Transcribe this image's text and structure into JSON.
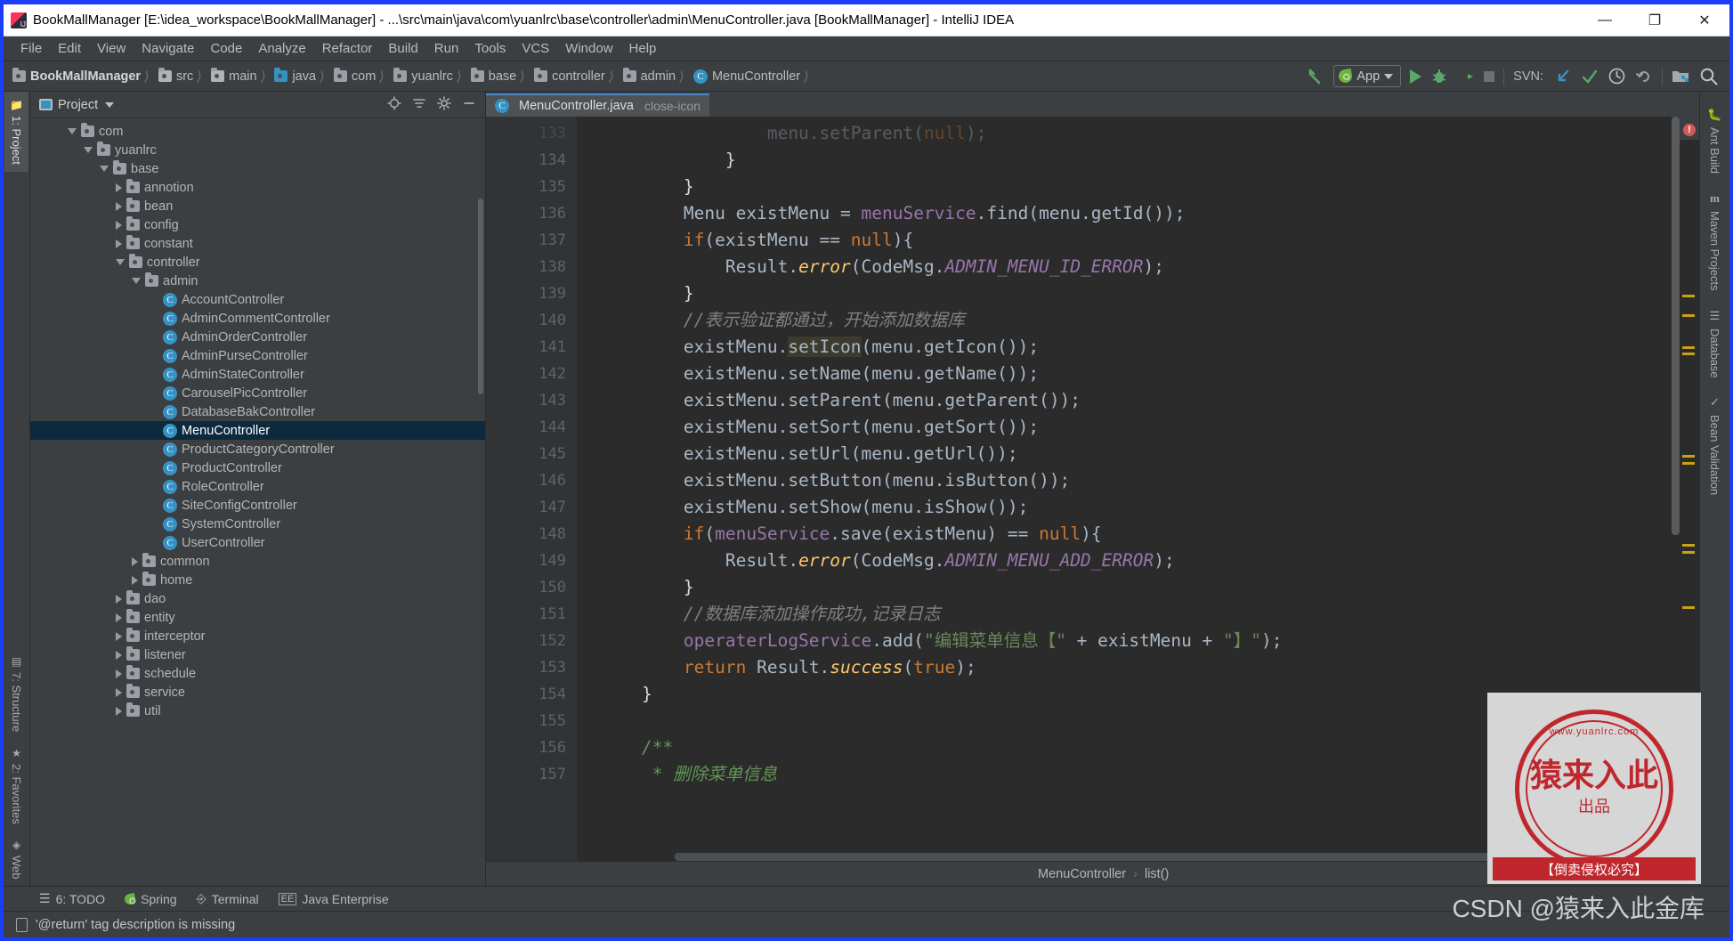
{
  "window": {
    "title": "BookMallManager [E:\\idea_workspace\\BookMallManager] - ...\\src\\main\\java\\com\\yuanlrc\\base\\controller\\admin\\MenuController.java [BookMallManager] - IntelliJ IDEA",
    "app_icon": "intellij-idea-icon",
    "minimize": "—",
    "maximize": "❐",
    "close": "✕"
  },
  "menubar": {
    "items": [
      {
        "label": "File"
      },
      {
        "label": "Edit"
      },
      {
        "label": "View"
      },
      {
        "label": "Navigate"
      },
      {
        "label": "Code"
      },
      {
        "label": "Analyze"
      },
      {
        "label": "Refactor"
      },
      {
        "label": "Build"
      },
      {
        "label": "Run"
      },
      {
        "label": "Tools"
      },
      {
        "label": "VCS"
      },
      {
        "label": "Window"
      },
      {
        "label": "Help"
      }
    ]
  },
  "navbar": {
    "breadcrumbs": [
      {
        "label": "BookMallManager",
        "icon": "project-folder-icon"
      },
      {
        "label": "src",
        "icon": "folder-icon"
      },
      {
        "label": "main",
        "icon": "folder-icon"
      },
      {
        "label": "java",
        "icon": "source-root-folder-icon"
      },
      {
        "label": "com",
        "icon": "package-icon"
      },
      {
        "label": "yuanlrc",
        "icon": "package-icon"
      },
      {
        "label": "base",
        "icon": "package-icon"
      },
      {
        "label": "controller",
        "icon": "package-icon"
      },
      {
        "label": "admin",
        "icon": "package-icon"
      },
      {
        "label": "MenuController",
        "icon": "java-class-icon"
      }
    ],
    "separator": "›",
    "toolbar": {
      "back_arrow_icon": "back-arrow-icon",
      "run_config_label": "App",
      "run_config_icon": "spring-leaf-icon",
      "dropdown_icon": "chevron-down-icon",
      "run_icon": "run-play-icon",
      "debug_icon": "debug-bug-icon",
      "run_coverage_icon": "run-with-coverage-icon",
      "stop_icon": "stop-square-icon",
      "svn_label": "SVN:",
      "svn_update_icon": "svn-update-icon",
      "svn_commit_icon": "svn-commit-check-icon",
      "svn_history_icon": "svn-history-clock-icon",
      "svn_revert_icon": "svn-revert-icon",
      "module_settings_icon": "project-structure-icon",
      "search_icon": "search-icon"
    }
  },
  "left_strip": {
    "tabs": [
      {
        "label": "1: Project",
        "icon": "project-folder-icon",
        "active": true
      },
      {
        "label": "7: Structure",
        "icon": "structure-icon",
        "active": false
      },
      {
        "label": "2: Favorites",
        "icon": "star-icon",
        "active": false
      },
      {
        "label": "Web",
        "icon": "web-globe-icon",
        "active": false
      }
    ]
  },
  "right_strip": {
    "tabs": [
      {
        "label": "Ant Build",
        "icon": "ant-icon"
      },
      {
        "label": "Maven Projects",
        "icon": "maven-m-icon"
      },
      {
        "label": "Database",
        "icon": "database-icon"
      },
      {
        "label": "Bean Validation",
        "icon": "bean-validation-icon"
      }
    ]
  },
  "project_panel": {
    "title": "Project",
    "title_dropdown_icon": "chevron-down-icon",
    "actions": [
      {
        "icon": "locate-target-icon"
      },
      {
        "icon": "collapse-all-icon"
      },
      {
        "icon": "settings-gear-icon"
      },
      {
        "icon": "hide-minus-icon"
      }
    ],
    "tree": [
      {
        "label": "com",
        "depth": 2,
        "state": "open",
        "icon": "package-icon",
        "selected": false
      },
      {
        "label": "yuanlrc",
        "depth": 3,
        "state": "open",
        "icon": "package-icon",
        "selected": false
      },
      {
        "label": "base",
        "depth": 4,
        "state": "open",
        "icon": "package-icon",
        "selected": false
      },
      {
        "label": "annotion",
        "depth": 5,
        "state": "closed",
        "icon": "package-icon",
        "selected": false
      },
      {
        "label": "bean",
        "depth": 5,
        "state": "closed",
        "icon": "package-icon",
        "selected": false
      },
      {
        "label": "config",
        "depth": 5,
        "state": "closed",
        "icon": "package-icon",
        "selected": false
      },
      {
        "label": "constant",
        "depth": 5,
        "state": "closed",
        "icon": "package-icon",
        "selected": false
      },
      {
        "label": "controller",
        "depth": 5,
        "state": "open",
        "icon": "package-icon",
        "selected": false
      },
      {
        "label": "admin",
        "depth": 6,
        "state": "open",
        "icon": "package-icon",
        "selected": false
      },
      {
        "label": "AccountController",
        "depth": 7,
        "state": "leaf",
        "icon": "java-class-icon",
        "selected": false
      },
      {
        "label": "AdminCommentController",
        "depth": 7,
        "state": "leaf",
        "icon": "java-class-icon",
        "selected": false
      },
      {
        "label": "AdminOrderController",
        "depth": 7,
        "state": "leaf",
        "icon": "java-class-icon",
        "selected": false
      },
      {
        "label": "AdminPurseController",
        "depth": 7,
        "state": "leaf",
        "icon": "java-class-icon",
        "selected": false
      },
      {
        "label": "AdminStateController",
        "depth": 7,
        "state": "leaf",
        "icon": "java-class-icon",
        "selected": false
      },
      {
        "label": "CarouselPicController",
        "depth": 7,
        "state": "leaf",
        "icon": "java-class-icon",
        "selected": false
      },
      {
        "label": "DatabaseBakController",
        "depth": 7,
        "state": "leaf",
        "icon": "java-class-icon",
        "selected": false
      },
      {
        "label": "MenuController",
        "depth": 7,
        "state": "leaf",
        "icon": "java-class-icon",
        "selected": true
      },
      {
        "label": "ProductCategoryController",
        "depth": 7,
        "state": "leaf",
        "icon": "java-class-icon",
        "selected": false
      },
      {
        "label": "ProductController",
        "depth": 7,
        "state": "leaf",
        "icon": "java-class-icon",
        "selected": false
      },
      {
        "label": "RoleController",
        "depth": 7,
        "state": "leaf",
        "icon": "java-class-icon",
        "selected": false
      },
      {
        "label": "SiteConfigController",
        "depth": 7,
        "state": "leaf",
        "icon": "java-class-icon",
        "selected": false
      },
      {
        "label": "SystemController",
        "depth": 7,
        "state": "leaf",
        "icon": "java-class-icon",
        "selected": false
      },
      {
        "label": "UserController",
        "depth": 7,
        "state": "leaf",
        "icon": "java-class-icon",
        "selected": false
      },
      {
        "label": "common",
        "depth": 6,
        "state": "closed",
        "icon": "package-icon",
        "selected": false
      },
      {
        "label": "home",
        "depth": 6,
        "state": "closed",
        "icon": "package-icon",
        "selected": false
      },
      {
        "label": "dao",
        "depth": 5,
        "state": "closed",
        "icon": "package-icon",
        "selected": false
      },
      {
        "label": "entity",
        "depth": 5,
        "state": "closed",
        "icon": "package-icon",
        "selected": false
      },
      {
        "label": "interceptor",
        "depth": 5,
        "state": "closed",
        "icon": "package-icon",
        "selected": false
      },
      {
        "label": "listener",
        "depth": 5,
        "state": "closed",
        "icon": "package-icon",
        "selected": false
      },
      {
        "label": "schedule",
        "depth": 5,
        "state": "closed",
        "icon": "package-icon",
        "selected": false
      },
      {
        "label": "service",
        "depth": 5,
        "state": "closed",
        "icon": "package-icon",
        "selected": false
      },
      {
        "label": "util",
        "depth": 5,
        "state": "closed",
        "icon": "package-icon",
        "selected": false
      }
    ]
  },
  "editor": {
    "tab": {
      "label": "MenuController.java",
      "icon": "java-class-icon",
      "close_icon": "close-icon"
    },
    "first_visible_line": 133,
    "lines": [
      {
        "num": "133",
        "fold": "",
        "segments": [
          {
            "t": "                menu.",
            "c": "plain"
          },
          {
            "t": "setParent",
            "c": "plain"
          },
          {
            "t": "(",
            "c": "plain"
          },
          {
            "t": "null",
            "c": "kw"
          },
          {
            "t": ");",
            "c": "plain"
          }
        ]
      },
      {
        "num": "134",
        "fold": "",
        "segments": [
          {
            "t": "            }",
            "c": "white"
          }
        ]
      },
      {
        "num": "135",
        "fold": "",
        "segments": [
          {
            "t": "        }",
            "c": "white"
          }
        ]
      },
      {
        "num": "136",
        "fold": "",
        "segments": [
          {
            "t": "        Menu existMenu = ",
            "c": "plain"
          },
          {
            "t": "menuService",
            "c": "fld"
          },
          {
            "t": ".find(menu.getId());",
            "c": "plain"
          }
        ]
      },
      {
        "num": "137",
        "fold": "",
        "segments": [
          {
            "t": "        ",
            "c": "plain"
          },
          {
            "t": "if",
            "c": "kw"
          },
          {
            "t": "(existMenu == ",
            "c": "plain"
          },
          {
            "t": "null",
            "c": "kw"
          },
          {
            "t": "){",
            "c": "plain"
          }
        ]
      },
      {
        "num": "138",
        "fold": "",
        "segments": [
          {
            "t": "            Result.",
            "c": "plain"
          },
          {
            "t": "error",
            "c": "it"
          },
          {
            "t": "(CodeMsg.",
            "c": "plain"
          },
          {
            "t": "ADMIN_MENU_ID_ERROR",
            "c": "fld-it"
          },
          {
            "t": ");",
            "c": "plain"
          }
        ]
      },
      {
        "num": "139",
        "fold": "",
        "segments": [
          {
            "t": "        }",
            "c": "white"
          }
        ]
      },
      {
        "num": "140",
        "fold": "",
        "segments": [
          {
            "t": "        //表示验证都通过，开始添加数据库",
            "c": "cmt"
          }
        ]
      },
      {
        "num": "141",
        "fold": "",
        "segments": [
          {
            "t": "        existMenu.",
            "c": "plain"
          },
          {
            "t": "setIcon",
            "c": "hl"
          },
          {
            "t": "(menu.getIcon());",
            "c": "plain"
          }
        ]
      },
      {
        "num": "142",
        "fold": "",
        "segments": [
          {
            "t": "        existMenu.setName(menu.getName());",
            "c": "plain"
          }
        ]
      },
      {
        "num": "143",
        "fold": "",
        "segments": [
          {
            "t": "        existMenu.setParent(menu.getParent());",
            "c": "plain"
          }
        ]
      },
      {
        "num": "144",
        "fold": "",
        "segments": [
          {
            "t": "        existMenu.setSort(menu.getSort());",
            "c": "plain"
          }
        ]
      },
      {
        "num": "145",
        "fold": "",
        "segments": [
          {
            "t": "        existMenu.setUrl(menu.getUrl());",
            "c": "plain"
          }
        ]
      },
      {
        "num": "146",
        "fold": "",
        "segments": [
          {
            "t": "        existMenu.setButton(menu.isButton());",
            "c": "plain"
          }
        ]
      },
      {
        "num": "147",
        "fold": "",
        "segments": [
          {
            "t": "        existMenu.setShow(menu.isShow());",
            "c": "plain"
          }
        ]
      },
      {
        "num": "148",
        "fold": "",
        "segments": [
          {
            "t": "        ",
            "c": "plain"
          },
          {
            "t": "if",
            "c": "kw"
          },
          {
            "t": "(",
            "c": "plain"
          },
          {
            "t": "menuService",
            "c": "fld"
          },
          {
            "t": ".save(existMenu) == ",
            "c": "plain"
          },
          {
            "t": "null",
            "c": "kw"
          },
          {
            "t": "){",
            "c": "plain"
          }
        ]
      },
      {
        "num": "149",
        "fold": "",
        "segments": [
          {
            "t": "            Result.",
            "c": "plain"
          },
          {
            "t": "error",
            "c": "it"
          },
          {
            "t": "(CodeMsg.",
            "c": "plain"
          },
          {
            "t": "ADMIN_MENU_ADD_ERROR",
            "c": "fld-it"
          },
          {
            "t": ");",
            "c": "plain"
          }
        ]
      },
      {
        "num": "150",
        "fold": "",
        "segments": [
          {
            "t": "        }",
            "c": "white"
          }
        ]
      },
      {
        "num": "151",
        "fold": "",
        "segments": [
          {
            "t": "        //数据库添加操作成功,记录日志",
            "c": "cmt"
          }
        ]
      },
      {
        "num": "152",
        "fold": "",
        "segments": [
          {
            "t": "        ",
            "c": "plain"
          },
          {
            "t": "operaterLogService",
            "c": "fld"
          },
          {
            "t": ".add(",
            "c": "plain"
          },
          {
            "t": "\"编辑菜单信息【\"",
            "c": "str"
          },
          {
            "t": " + existMenu + ",
            "c": "plain"
          },
          {
            "t": "\"】\"",
            "c": "str"
          },
          {
            "t": ");",
            "c": "plain"
          }
        ]
      },
      {
        "num": "153",
        "fold": "",
        "segments": [
          {
            "t": "        ",
            "c": "plain"
          },
          {
            "t": "return",
            "c": "kw"
          },
          {
            "t": " Result.",
            "c": "plain"
          },
          {
            "t": "success",
            "c": "it"
          },
          {
            "t": "(",
            "c": "plain"
          },
          {
            "t": "true",
            "c": "kw"
          },
          {
            "t": ");",
            "c": "plain"
          }
        ]
      },
      {
        "num": "154",
        "fold": "fold-end",
        "segments": [
          {
            "t": "    }",
            "c": "white"
          }
        ]
      },
      {
        "num": "155",
        "fold": "",
        "segments": [
          {
            "t": "",
            "c": "plain"
          }
        ]
      },
      {
        "num": "156",
        "fold": "fold-start",
        "segments": [
          {
            "t": "    /**",
            "c": "cmt-doc"
          }
        ]
      },
      {
        "num": "157",
        "fold": "",
        "segments": [
          {
            "t": "     * 删除菜单信息",
            "c": "cmt-doc"
          }
        ]
      }
    ],
    "breadcrumb": {
      "class": "MenuController",
      "method": "list()",
      "separator": "›"
    }
  },
  "tool_window_bar": {
    "items": [
      {
        "label": "6: TODO",
        "icon": "todo-list-icon"
      },
      {
        "label": "Spring",
        "icon": "spring-leaf-icon"
      },
      {
        "label": "Terminal",
        "icon": "terminal-icon"
      },
      {
        "label": "Java Enterprise",
        "icon": "java-enterprise-icon"
      }
    ]
  },
  "statusbar": {
    "message": "'@return' tag description is missing",
    "icon": "inspection-icon"
  },
  "watermark": {
    "stamp_top_text": "www.yuanlrc.com",
    "stamp_main_text": "猿来入此",
    "stamp_sub_text": "出品",
    "stamp_banner_text": "【倒卖侵权必究】",
    "csdn_text": "CSDN @猿来入此金库"
  },
  "colors": {
    "window_border": "#1b3df5",
    "chrome_bg": "#3c3f41",
    "editor_bg": "#2b2b2b",
    "gutter_bg": "#313335",
    "selection_bg": "#0d293e",
    "accent_blue": "#3592c4",
    "keyword_orange": "#cc7832",
    "field_purple": "#9876aa",
    "string_green": "#6a8759",
    "comment_gray": "#808080",
    "doc_comment_green": "#629755",
    "text_default": "#a9b7c6",
    "tab_underline": "#4a88c7",
    "stamp_red": "#c0272d"
  }
}
